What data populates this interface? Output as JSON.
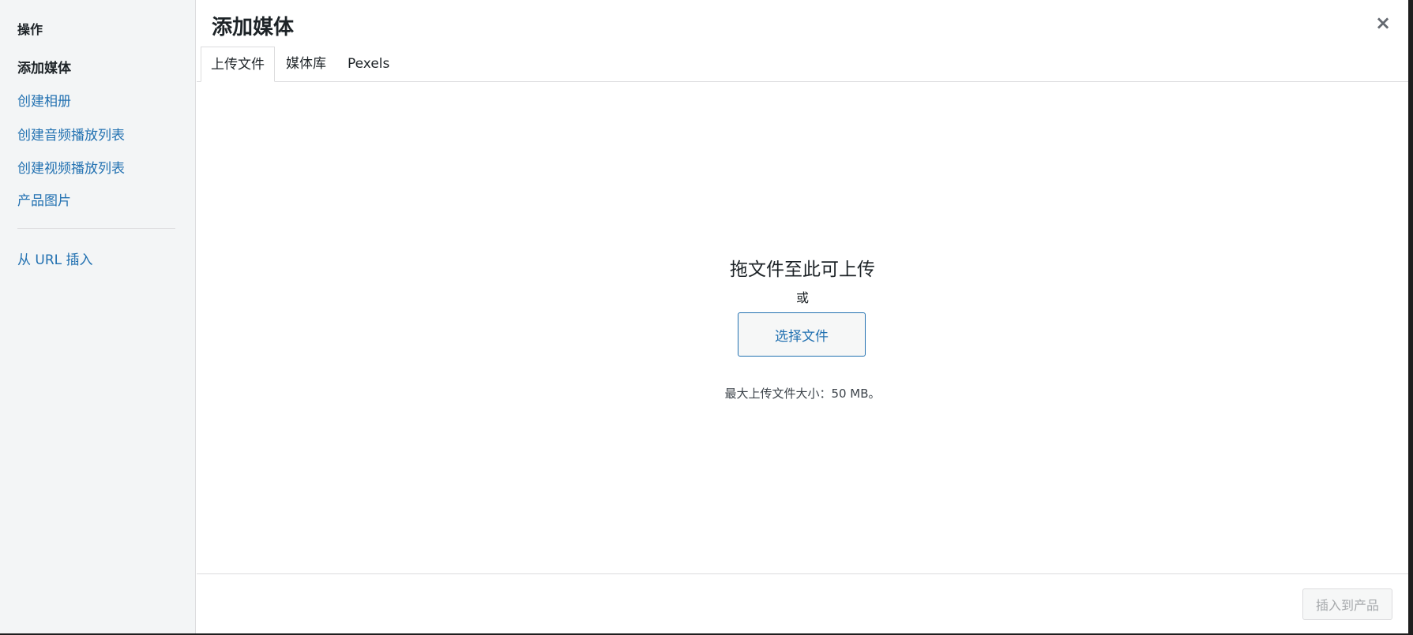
{
  "sidebar": {
    "heading": "操作",
    "items": [
      {
        "label": "添加媒体",
        "active": true
      },
      {
        "label": "创建相册"
      },
      {
        "label": "创建音频播放列表"
      },
      {
        "label": "创建视频播放列表"
      },
      {
        "label": "产品图片"
      }
    ],
    "url_item": "从 URL 插入"
  },
  "header": {
    "title": "添加媒体",
    "close_icon": "×"
  },
  "tabs": [
    {
      "label": "上传文件"
    },
    {
      "label": "媒体库"
    },
    {
      "label": "Pexels"
    }
  ],
  "upload": {
    "drop_text": "拖文件至此可上传",
    "or_text": "或",
    "select_button": "选择文件",
    "max_size": "最大上传文件大小：50 MB。"
  },
  "footer": {
    "insert_button": "插入到产品"
  }
}
